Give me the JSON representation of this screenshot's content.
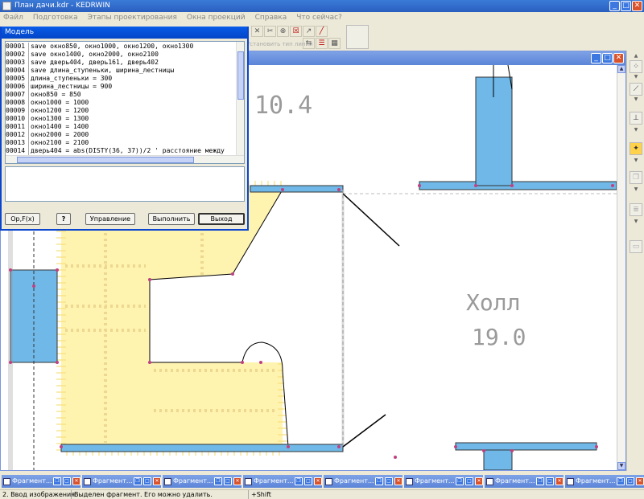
{
  "window": {
    "title": "План дачи.kdr - KEDRWIN"
  },
  "menu": [
    "Файл",
    "Подготовка",
    "Этапы проектирования",
    "Окна проекций",
    "Справка",
    "Что сейчас?"
  ],
  "toolbar": {
    "hint": "Установить тип линии"
  },
  "dialog": {
    "title": "Модель",
    "line_numbers": [
      "00001",
      "00002",
      "00003",
      "00004",
      "00005",
      "00006",
      "00007",
      "00008",
      "00009",
      "00010",
      "00011",
      "00012",
      "00013",
      "00014"
    ],
    "lines": [
      "save окно850, окно1000, окно1200, окно1300",
      "save окно1400, окно2000, окно2100",
      "save дверь404, дверь161, дверь402",
      "save длина_ступеньки, ширина_лестницы",
      "длина_ступеньки = 300",
      "ширина_лестницы = 900",
      "окно850 = 850",
      "окно1000 = 1000",
      "окно1200 = 1200",
      "окно1300 = 1300",
      "окно1400 = 1400",
      "окно2000 = 2000",
      "окно2100 = 2100",
      "дверь404 = abs(DISTY(36, 37))/2 ' расстояние между"
    ],
    "buttons": {
      "opfx": "Op,F(x)",
      "help": "?",
      "manage": "Управление",
      "run": "Выполнить",
      "exit": "Выход"
    }
  },
  "plan": {
    "room1_label": "10.4",
    "room2_name": "Холл",
    "room2_area": "19.0"
  },
  "fragments": [
    "Фрагмент...",
    "Фрагмент...",
    "Фрагмент...",
    "Фрагмент...",
    "Фрагмент...",
    "Фрагмент...",
    "Фрагмент...",
    "Фрагмент..."
  ],
  "status": {
    "mode": "2. Ввод изображения",
    "message": "Выделен фрагмент. Его можно удалить.",
    "key": "+Shift"
  },
  "colors": {
    "wall": "#6fb8e8",
    "stairs": "#fff3b0",
    "accent": "#0a45d0"
  }
}
